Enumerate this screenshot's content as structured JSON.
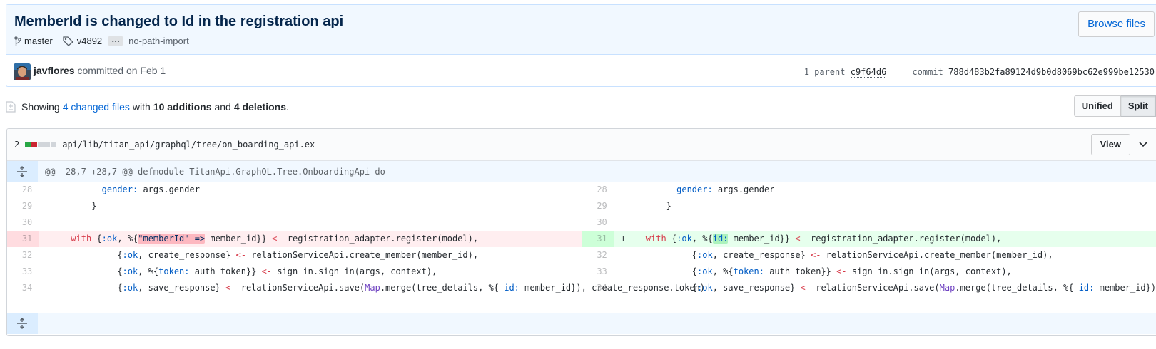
{
  "commit": {
    "title": "MemberId is changed to Id in the registration api",
    "browse_label": "Browse files",
    "branch": "master",
    "tag": "v4892",
    "ellipsis": "…",
    "more_branch": "no-path-import",
    "author": "javflores",
    "committed_text": "committed on Feb 1",
    "parent_label": "1 parent",
    "parent_sha": "c9f64d6",
    "commit_label": "commit",
    "commit_sha": "788d483b2fa89124d9b0d8069bc62e999be12530"
  },
  "toc": {
    "showing": "Showing",
    "changed_files": "4 changed files",
    "with": "with",
    "additions": "10 additions",
    "and": "and",
    "deletions": "4 deletions",
    "period": ".",
    "unified_label": "Unified",
    "split_label": "Split"
  },
  "file": {
    "change_count": "2",
    "path": "api/lib/titan_api/graphql/tree/on_boarding_api.ex",
    "view_label": "View",
    "hunk_header": "@@ -28,7 +28,7 @@ defmodule TitanApi.GraphQL.Tree.OnboardingApi do",
    "colors": {
      "add": "#28a745",
      "del": "#cb2431",
      "neutral": "#d1d5da"
    }
  },
  "diff": {
    "line_numbers": [
      "28",
      "29",
      "30",
      "31",
      "32",
      "33",
      "34"
    ],
    "del_marker": "-",
    "add_marker": "+",
    "lines": {
      "l28_key": "gender:",
      "l28_rest": " args.gender",
      "l29": "}",
      "l31_with": "with",
      "l31_ok": ":ok",
      "l31_pre": "{",
      "l31_comma": ", %{",
      "l31_del_hl": "\"memberId\" =>",
      "l31_add_hl": "id:",
      "l31_post": " member_id}} ",
      "l31_arrow": "<-",
      "l31_tail": " registration_adapter.register(model),",
      "l32_pre": "{",
      "l32_ok": ":ok",
      "l32_mid": ", create_response} ",
      "l32_arrow": "<-",
      "l32_tail": " relationServiceApi.create_member(member_id),",
      "l33_pre": "{",
      "l33_ok": ":ok",
      "l33_mid": ", %{",
      "l33_token": "token:",
      "l33_mid2": " auth_token}} ",
      "l33_arrow": "<-",
      "l33_tail": " sign_in.sign_in(args, context),",
      "l34_pre": "{",
      "l34_ok": ":ok",
      "l34_mid": ", save_response} ",
      "l34_arrow": "<-",
      "l34_mid2": " relationServiceApi.save(",
      "l34_map": "Map",
      "l34_mid3": ".merge(tree_details, %{ ",
      "l34_id": "id:",
      "l34_tail": " member_id}),",
      "l34_wrap": "create_response.token)"
    }
  }
}
